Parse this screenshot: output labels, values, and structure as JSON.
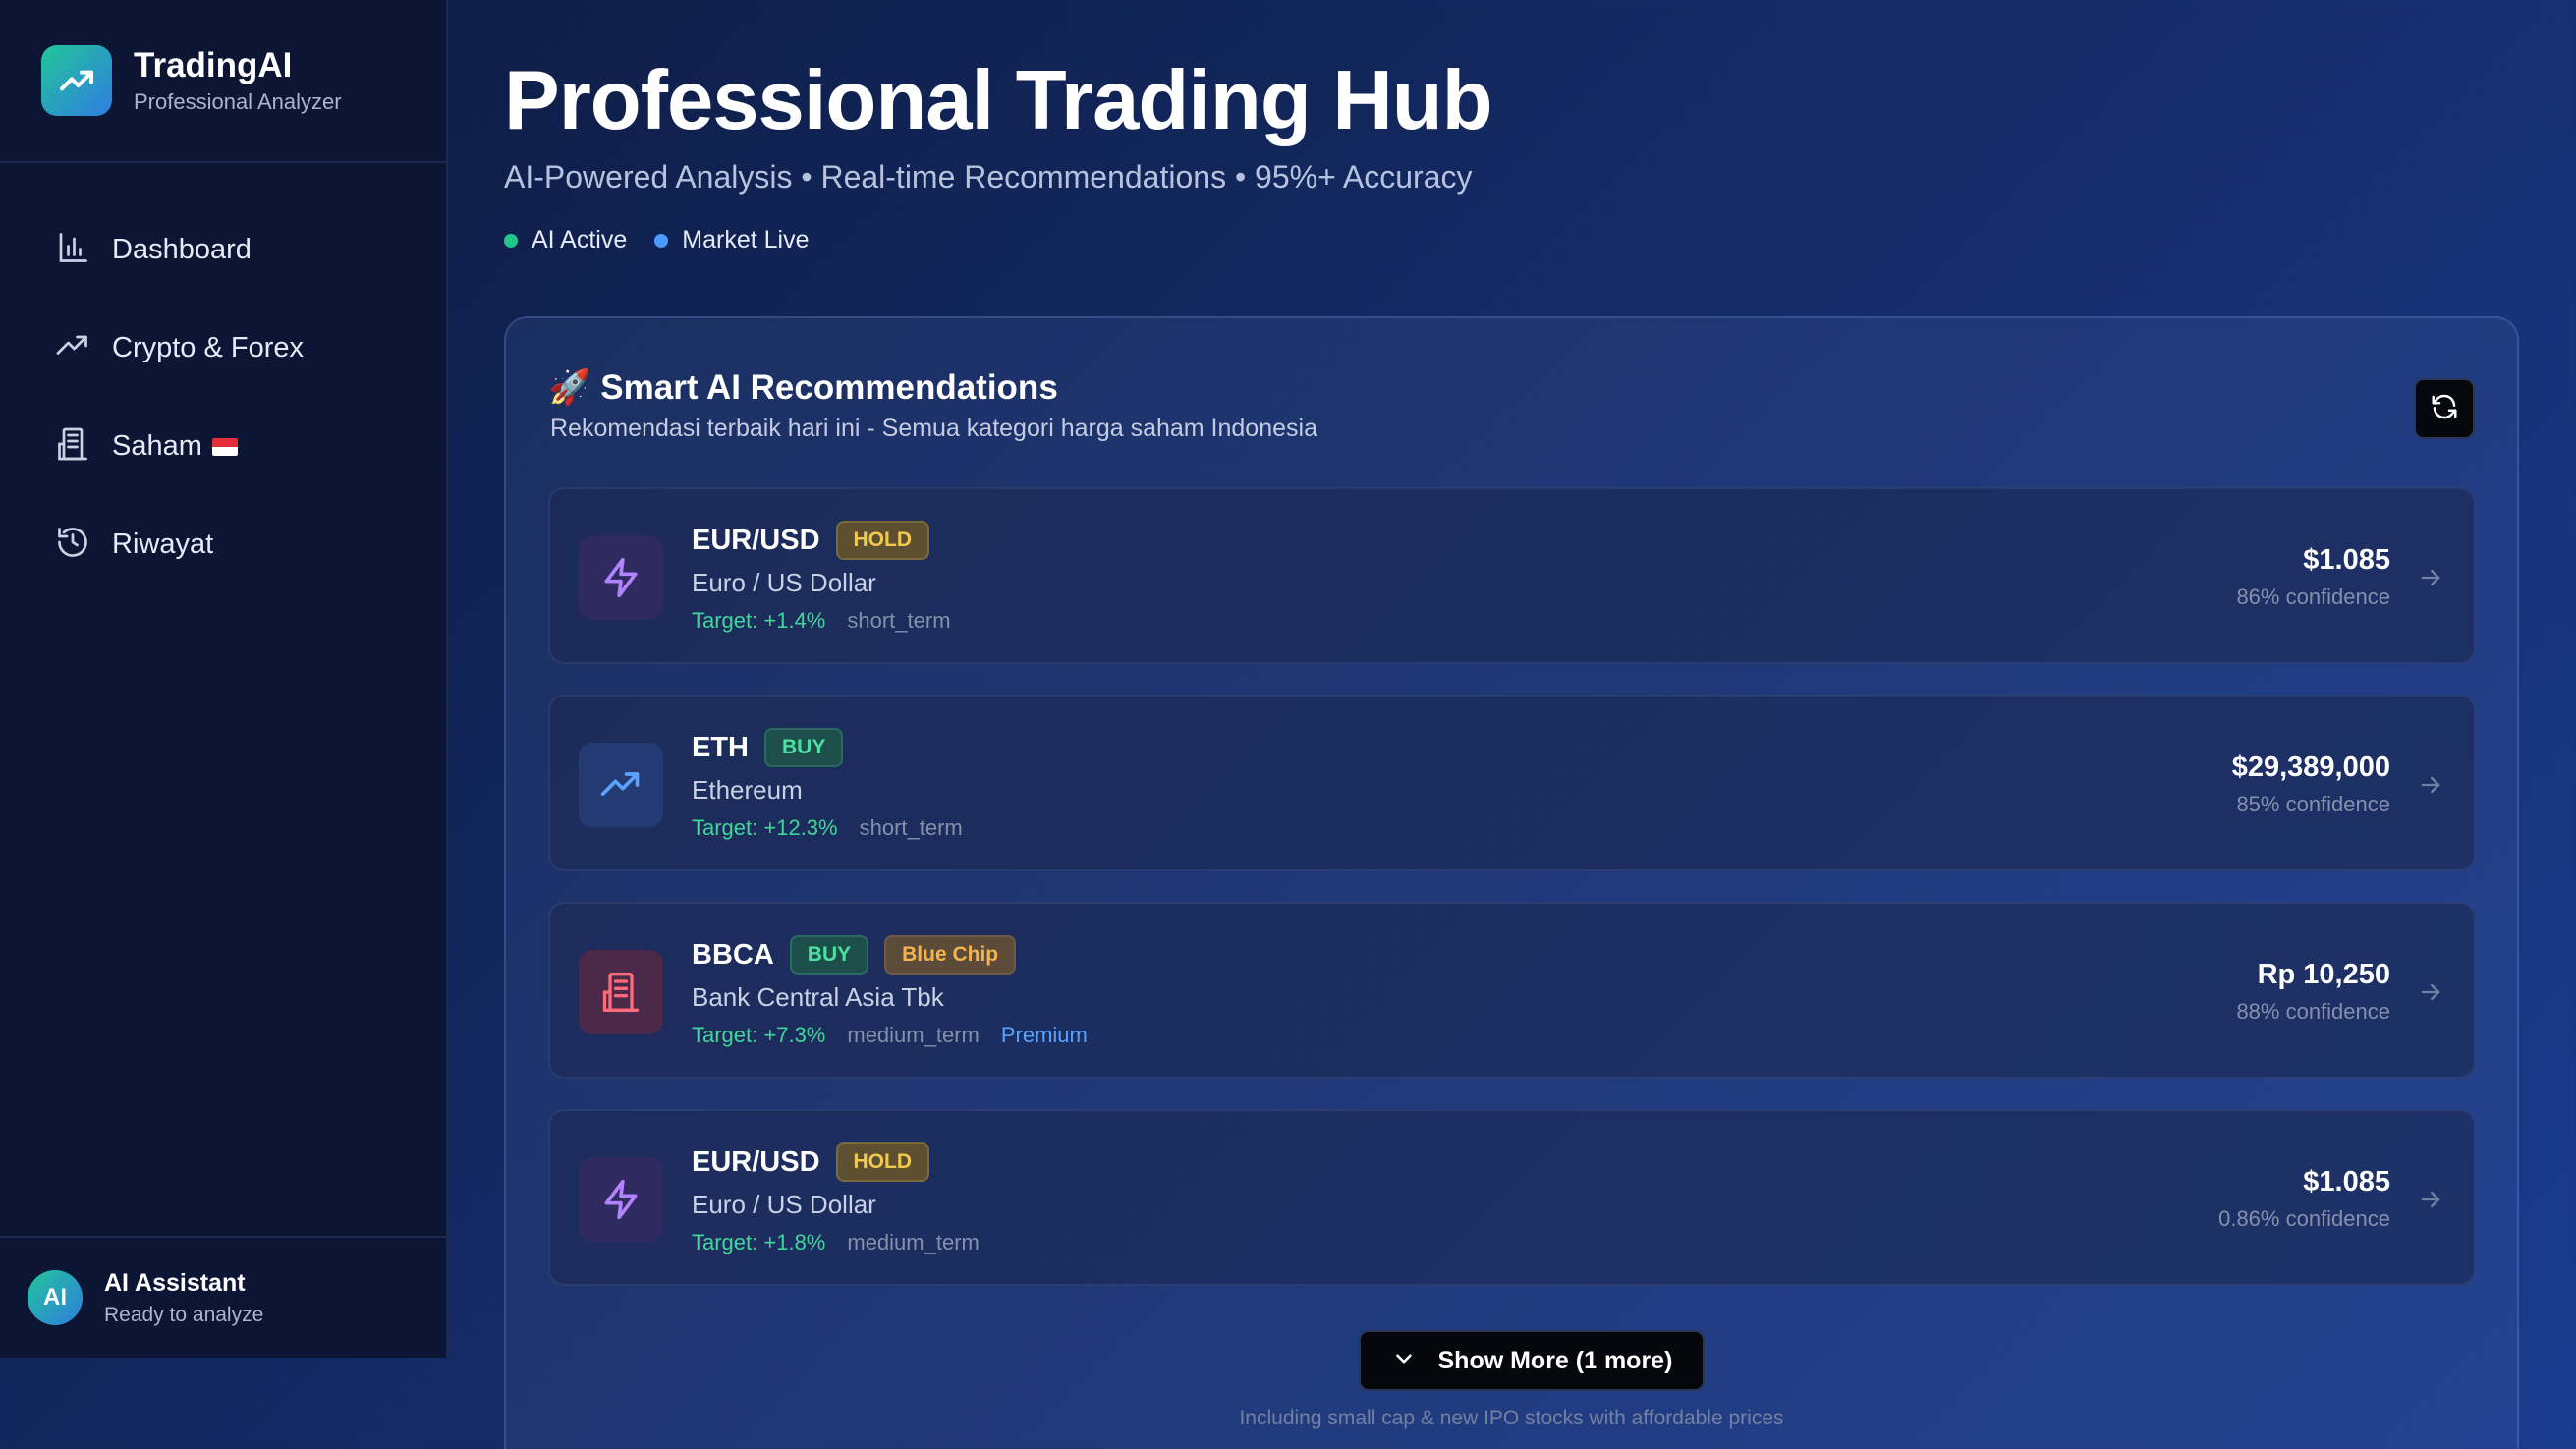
{
  "brand": {
    "title": "TradingAI",
    "subtitle": "Professional Analyzer"
  },
  "nav": [
    {
      "label": "Dashboard",
      "icon": "bar-chart-icon"
    },
    {
      "label": "Crypto & Forex",
      "icon": "trending-up-icon"
    },
    {
      "label": "Saham",
      "icon": "building-icon"
    },
    {
      "label": "Riwayat",
      "icon": "history-icon"
    }
  ],
  "assistant": {
    "avatar": "AI",
    "title": "AI Assistant",
    "subtitle": "Ready to analyze"
  },
  "header": {
    "title": "Professional Trading Hub",
    "subtitle": "AI-Powered Analysis • Real-time Recommendations • 95%+ Accuracy",
    "status": [
      {
        "label": "AI Active",
        "color": "#22c58b"
      },
      {
        "label": "Market Live",
        "color": "#4b9bff"
      }
    ]
  },
  "panel": {
    "title": "🚀 Smart AI Recommendations",
    "subtitle": "Rekomendasi terbaik hari ini - Semua kategori harga saham Indonesia",
    "show_more": "Show More (1 more)",
    "footnote": "Including small cap & new IPO stocks with affordable prices"
  },
  "recommendations": [
    {
      "symbol": "EUR/USD",
      "action": "HOLD",
      "name": "Euro / US Dollar",
      "target": "Target: +1.4%",
      "term": "short_term",
      "price": "$1.085",
      "confidence": "86% confidence",
      "icon": "lightning-icon"
    },
    {
      "symbol": "ETH",
      "action": "BUY",
      "name": "Ethereum",
      "target": "Target: +12.3%",
      "term": "short_term",
      "price": "$29,389,000",
      "confidence": "85% confidence",
      "icon": "trending-up-icon"
    },
    {
      "symbol": "BBCA",
      "action": "BUY",
      "tag": "Blue Chip",
      "name": "Bank Central Asia Tbk",
      "target": "Target: +7.3%",
      "term": "medium_term",
      "extra": "Premium",
      "price": "Rp 10,250",
      "confidence": "88% confidence",
      "icon": "building-icon"
    },
    {
      "symbol": "EUR/USD",
      "action": "HOLD",
      "name": "Euro / US Dollar",
      "target": "Target: +1.8%",
      "term": "medium_term",
      "price": "$1.085",
      "confidence": "0.86% confidence",
      "icon": "lightning-icon"
    }
  ]
}
